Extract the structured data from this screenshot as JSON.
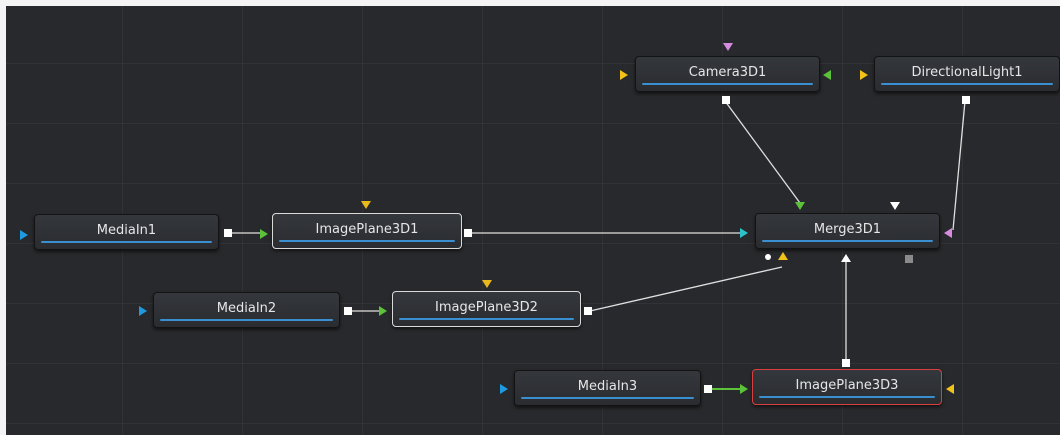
{
  "flow": {
    "nodes": {
      "camera": {
        "label": "Camera3D1"
      },
      "light": {
        "label": "DirectionalLight1"
      },
      "mediain1": {
        "label": "MediaIn1"
      },
      "imageplane1": {
        "label": "ImagePlane3D1"
      },
      "merge": {
        "label": "Merge3D1"
      },
      "mediain2": {
        "label": "MediaIn2"
      },
      "imageplane2": {
        "label": "ImagePlane3D2"
      },
      "mediain3": {
        "label": "MediaIn3"
      },
      "imageplane3": {
        "label": "ImagePlane3D3"
      }
    },
    "colors": {
      "background": "#28292c",
      "node_bar": "#3a8fd0",
      "wire": "#e0e0e0",
      "active_wire": "#5cc23a",
      "active_outline": "#d84040",
      "selected_outline": "#d9d9d9"
    }
  }
}
